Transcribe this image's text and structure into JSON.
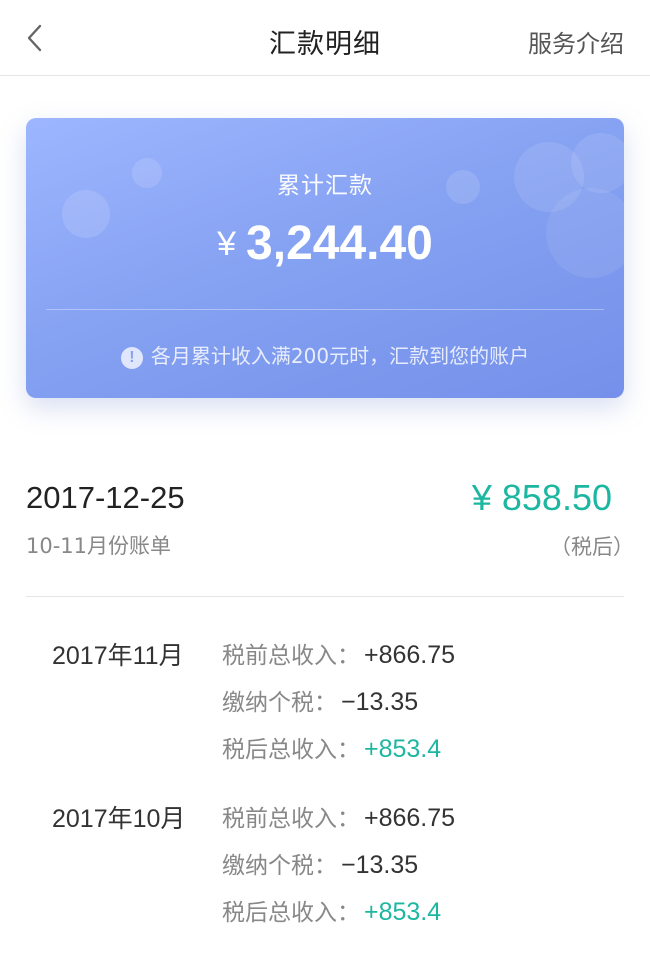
{
  "header": {
    "title": "汇款明细",
    "service_link": "服务介绍"
  },
  "summary": {
    "label": "累计汇款",
    "currency": "¥",
    "amount": "3,244.40",
    "note": "各月累计收入满200元时，汇款到您的账户"
  },
  "record": {
    "date": "2017-12-25",
    "bill": "10-11月份账单",
    "currency": "¥",
    "amount": "858.50",
    "tax_note": "（税后）"
  },
  "months": [
    {
      "label": "2017年11月",
      "pre_tax_label": "税前总收入：",
      "pre_tax": "+866.75",
      "tax_label": "缴纳个税：",
      "tax": "−13.35",
      "post_tax_label": "税后总收入：",
      "post_tax": "+853.4"
    },
    {
      "label": "2017年10月",
      "pre_tax_label": "税前总收入：",
      "pre_tax": "+866.75",
      "tax_label": "缴纳个税：",
      "tax": "−13.35",
      "post_tax_label": "税后总收入：",
      "post_tax": "+853.4"
    }
  ],
  "colors": {
    "accent_green": "#1db7a1",
    "card_gradient_start": "#9db6ff",
    "card_gradient_end": "#7490ea"
  }
}
